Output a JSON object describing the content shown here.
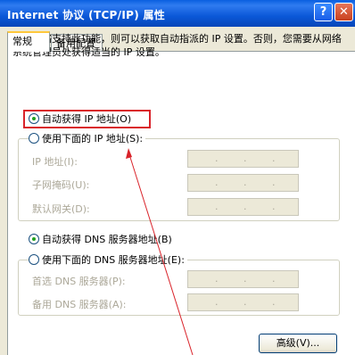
{
  "window": {
    "title": "Internet 协议 (TCP/IP) 属性",
    "help_label": "?",
    "close_label": "✕"
  },
  "tabs": [
    {
      "label": "常规",
      "active": true
    },
    {
      "label": "备用配置",
      "active": false
    }
  ],
  "description": "如果网络支持此功能，则可以获取自动指派的 IP 设置。否则，您需要从网络系统管理员处获得适当的 IP 设置。",
  "ip_section": {
    "auto_label": "自动获得 IP 地址(O)",
    "auto_selected": true,
    "manual_label": "使用下面的 IP 地址(S):",
    "manual_selected": false,
    "fields": [
      {
        "label": "IP 地址(I):",
        "dots": [
          ".",
          ".",
          "."
        ]
      },
      {
        "label": "子网掩码(U):",
        "dots": [
          ".",
          ".",
          "."
        ]
      },
      {
        "label": "默认网关(D):",
        "dots": [
          ".",
          ".",
          "."
        ]
      }
    ]
  },
  "dns_section": {
    "auto_label": "自动获得 DNS 服务器地址(B)",
    "auto_selected": true,
    "manual_label": "使用下面的 DNS 服务器地址(E):",
    "manual_selected": false,
    "fields": [
      {
        "label": "首选 DNS 服务器(P):",
        "dots": [
          ".",
          ".",
          "."
        ]
      },
      {
        "label": "备用 DNS 服务器(A):",
        "dots": [
          ".",
          ".",
          "."
        ]
      }
    ]
  },
  "advanced_label": "高级(V)...",
  "colors": {
    "highlight_border": "#d9232a",
    "annotation_arrow": "#d9232a",
    "titlebar": "#0a5fe0",
    "dialog_bg": "#ece9d8"
  }
}
